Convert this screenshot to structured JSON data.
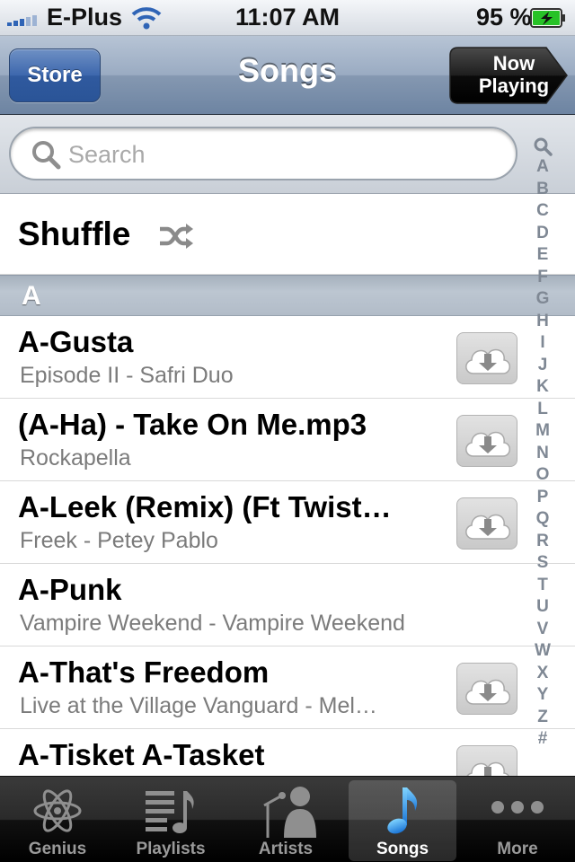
{
  "status_bar": {
    "carrier": "E-Plus",
    "time": "11:07 AM",
    "battery_percent": "95 %"
  },
  "nav": {
    "left_button": "Store",
    "title": "Songs",
    "right_button_line1": "Now",
    "right_button_line2": "Playing"
  },
  "search": {
    "placeholder": "Search"
  },
  "shuffle": {
    "label": "Shuffle"
  },
  "section": {
    "letter": "A"
  },
  "songs": [
    {
      "title": "A-Gusta",
      "subtitle": "Episode II - Safri Duo",
      "cloud": true
    },
    {
      "title": "(A-Ha) - Take On Me.mp3",
      "subtitle": "Rockapella",
      "cloud": true
    },
    {
      "title": "A-Leek (Remix) (Ft Twist…",
      "subtitle": "Freek - Petey Pablo",
      "cloud": true
    },
    {
      "title": "A-Punk",
      "subtitle": "Vampire Weekend - Vampire Weekend",
      "cloud": false
    },
    {
      "title": "A-That's Freedom",
      "subtitle": "Live at the Village Vanguard - Mel…",
      "cloud": true
    },
    {
      "title": "A-Tisket A-Tasket",
      "subtitle": "",
      "cloud": true
    }
  ],
  "index": [
    "A",
    "B",
    "C",
    "D",
    "E",
    "F",
    "G",
    "H",
    "I",
    "J",
    "K",
    "L",
    "M",
    "N",
    "O",
    "P",
    "Q",
    "R",
    "S",
    "T",
    "U",
    "V",
    "W",
    "X",
    "Y",
    "Z",
    "#"
  ],
  "tabs": [
    {
      "label": "Genius",
      "icon": "atom-icon",
      "selected": false
    },
    {
      "label": "Playlists",
      "icon": "playlist-icon",
      "selected": false
    },
    {
      "label": "Artists",
      "icon": "singer-icon",
      "selected": false
    },
    {
      "label": "Songs",
      "icon": "music-note-icon",
      "selected": true
    },
    {
      "label": "More",
      "icon": "more-dots-icon",
      "selected": false
    }
  ],
  "colors": {
    "nav_bar": "#8598b1",
    "store_button": "#3d67ad",
    "selected_tab_icon": "#2f8fe8",
    "subtitle_text": "#7b7b7b",
    "index_text": "#7f8894"
  }
}
